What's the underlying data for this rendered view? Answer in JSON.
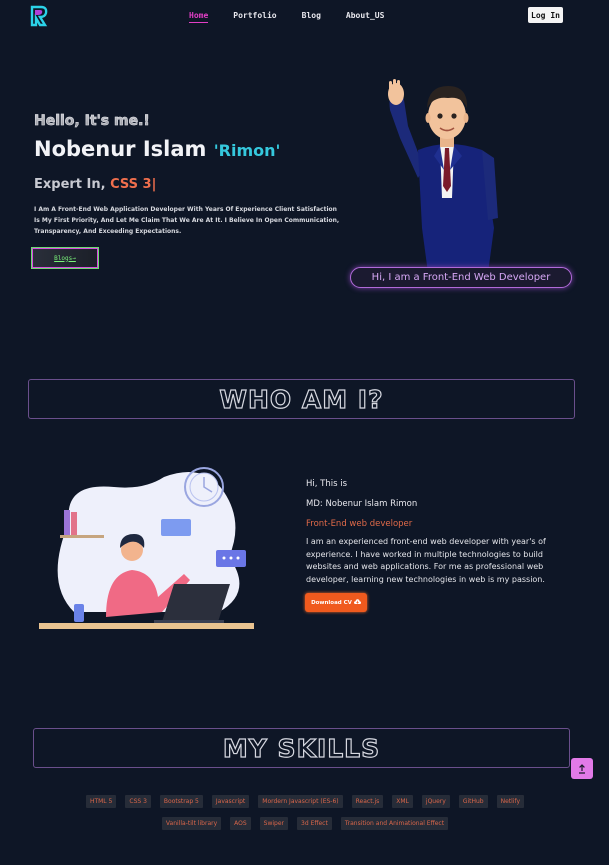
{
  "nav": {
    "links": [
      {
        "label": "Home",
        "active": true
      },
      {
        "label": "Portfolio",
        "active": false
      },
      {
        "label": "Blog",
        "active": false
      },
      {
        "label": "About_US",
        "active": false
      }
    ],
    "login_label": "Log In",
    "logo_icon": "logo-icon"
  },
  "hero": {
    "greeting": "Hello, It's me.!",
    "name": "Nobenur Islam ",
    "nickname": "'Rimon'",
    "expert_prefix": "Expert In, ",
    "expert_skill": "CSS 3|",
    "intro": "I Am A Front-End Web Application Developer With Years Of Experience Client Satisfaction Is My First Priority, And Let Me Claim That We Are At It. I Believe In Open Communication, Transparency, And Exceeding Expectations.",
    "button_label": "Blogs→",
    "tagline": "Hi, I am a Front-End Web Developer"
  },
  "about": {
    "title": "WHO AM I?",
    "hi": "Hi, This is",
    "name": "MD: Nobenur Islam Rimon",
    "role": "Front-End web developer",
    "description": "I am an experienced front-end web developer with year's of experience. I have worked in multiple technologies to build websites and web applications. For me as professional web developer, learning new technologies in web is my passion.",
    "cv_label": "Download CV"
  },
  "skills": {
    "title": "MY SKILLS",
    "row1": [
      "HTML 5",
      "CSS 3",
      "Bootstrap 5",
      "Javascript",
      "Mordern Javascript (ES-6)",
      "React.js",
      "XML",
      "jQuery",
      "GitHub",
      "Netlify"
    ],
    "row2": [
      "Vanilla-tilt library",
      "AOS",
      "Swiper",
      "3d Effect",
      "Transition and Animational Effect"
    ]
  },
  "colors": {
    "background": "#0e1626",
    "accent_pink": "#e23fc6",
    "accent_cyan": "#35c8dd",
    "accent_orange": "#f05a1e",
    "tag_text": "#d9664a"
  }
}
